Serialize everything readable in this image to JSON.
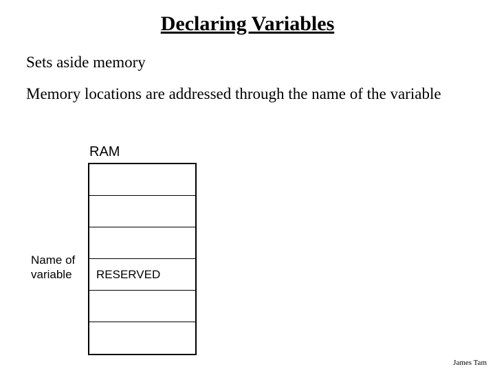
{
  "title": "Declaring Variables",
  "bullets": {
    "line1": "Sets aside memory",
    "line2": "Memory locations are addressed through the name of the variable"
  },
  "ram": {
    "heading": "RAM",
    "cells": [
      "",
      "",
      "",
      "RESERVED",
      "",
      ""
    ]
  },
  "var_label": "Name of variable",
  "footer": "James Tam"
}
